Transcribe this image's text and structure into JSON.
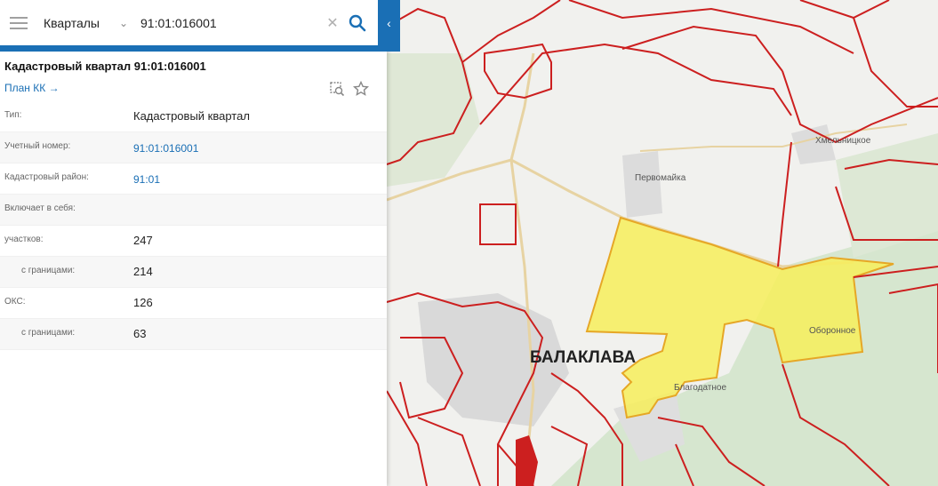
{
  "search": {
    "layer": "Кварталы",
    "query": "91:01:016001"
  },
  "card": {
    "title": "Кадастровый квартал 91:01:016001",
    "plan_link": "План КК →"
  },
  "rows": [
    {
      "label": "Тип:",
      "value": "Кадастровый квартал"
    },
    {
      "label": "Учетный номер:",
      "value": "91:01:016001"
    },
    {
      "label": "Кадастровый район:",
      "value": "91:01"
    },
    {
      "label": "Включает в себя:",
      "value": ""
    },
    {
      "label": "участков:",
      "value": "247"
    },
    {
      "label": "с границами:",
      "value": "214"
    },
    {
      "label": "ОКС:",
      "value": "126"
    },
    {
      "label": "с границами:",
      "value": "63"
    }
  ],
  "map": {
    "labels": {
      "khmelnitskoe": "Хмельницкое",
      "pervomaika": "Первомайка",
      "balaklava": "БАЛАКЛАВА",
      "oboronnoe": "Оборонное",
      "blagodatnoe": "Благодатное"
    },
    "colors": {
      "boundary": "#cc1f1f",
      "highlight_fill": "#f7ee5a",
      "highlight_stroke": "#e6a726",
      "accent": "#1a6fb5"
    }
  }
}
